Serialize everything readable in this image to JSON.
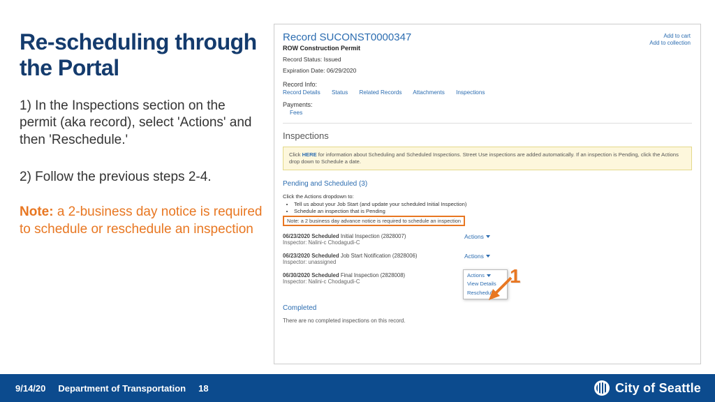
{
  "title": "Re-scheduling through the Portal",
  "step1": "1) In the Inspections section on the permit (aka record), select 'Actions' and then 'Reschedule.'",
  "step2": "2) Follow the previous steps 2-4.",
  "note_label": "Note:",
  "note_body": " a 2-business day notice is required to schedule or reschedule an inspection",
  "callout": "1",
  "footer": {
    "date": "9/14/20",
    "dept": "Department of Transportation",
    "page": "18",
    "city": "City of Seattle"
  },
  "shot": {
    "record_prefix": "Record ",
    "record_id": "SUCONST0000347",
    "subtitle": "ROW Construction Permit",
    "status": "Record Status: Issued",
    "expiration": "Expiration Date: 06/29/2020",
    "top_links": {
      "cart": "Add to cart",
      "collection": "Add to collection"
    },
    "record_info_label": "Record Info:",
    "tabs": [
      "Record Details",
      "Status",
      "Related Records",
      "Attachments",
      "Inspections"
    ],
    "payments_label": "Payments:",
    "fees": "Fees",
    "inspections_header": "Inspections",
    "infobox_prefix": "Click ",
    "infobox_link": "HERE",
    "infobox_rest": " for information about Scheduling and Scheduled Inspections. Street Use inspections are added automatically. If an inspection is Pending, click the Actions drop down to Schedule a date.",
    "pending_header": "Pending and Scheduled (3)",
    "instr_lead": "Click the Actions dropdown to:",
    "instr_bullets": [
      "Tell us about your Job Start (and update your scheduled Initial Inspection)",
      "Schedule an inspection that is Pending"
    ],
    "orange_note": "Note: a 2 business day advance notice is required to schedule an inspection",
    "rows": [
      {
        "date": "06/23/2020",
        "status": "Scheduled",
        "title": "Initial Inspection (2828007)",
        "inspector": "Inspector: Nalini-c Chodagudi-C"
      },
      {
        "date": "06/23/2020",
        "status": "Scheduled",
        "title": "Job Start Notification (2828006)",
        "inspector": "Inspector: unassigned"
      },
      {
        "date": "06/30/2020",
        "status": "Scheduled",
        "title": "Final Inspection (2828008)",
        "inspector": "Inspector: Nalini-c Chodagudi-C"
      }
    ],
    "actions_label": "Actions",
    "popup": {
      "view": "View Details",
      "reschedule": "Reschedule"
    },
    "completed_header": "Completed",
    "completed_text": "There are no completed inspections on this record."
  }
}
